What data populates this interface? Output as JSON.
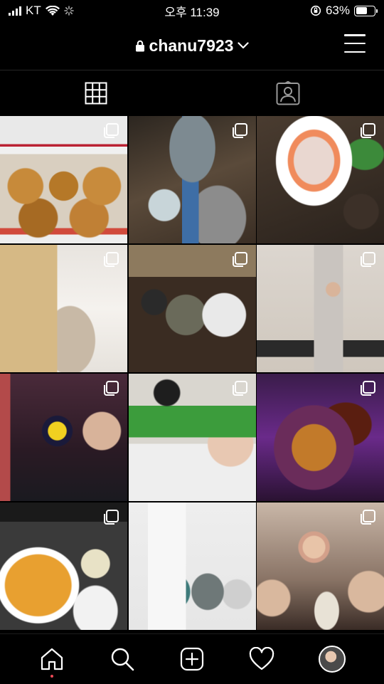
{
  "status_bar": {
    "carrier": "KT",
    "time": "오후 11:39",
    "battery": "63%",
    "battery_level": 0.63
  },
  "header": {
    "username": "chanu7923"
  },
  "tabs": [
    {
      "name": "posts-grid",
      "icon": "grid-icon",
      "active": true
    },
    {
      "name": "tagged",
      "icon": "tagged-person-icon",
      "active": false
    }
  ],
  "posts": [
    {
      "description": "fried chicken boxes",
      "multi": true
    },
    {
      "description": "soju bottle and grill",
      "multi": true
    },
    {
      "description": "sashimi platter",
      "multi": true
    },
    {
      "description": "rice cake gift bags",
      "multi": true
    },
    {
      "description": "group dinner at table",
      "multi": true
    },
    {
      "description": "busker with mic stand",
      "multi": true
    },
    {
      "description": "selfie in bar",
      "multi": true
    },
    {
      "description": "volunteers selfie",
      "multi": true
    },
    {
      "description": "spicy chicken noodle plate",
      "multi": true
    },
    {
      "description": "tteokbokki bowl",
      "multi": true
    },
    {
      "description": "airpods cases",
      "multi": false
    },
    {
      "description": "friends at restaurant",
      "multi": true
    }
  ],
  "bottom_nav": [
    {
      "name": "home",
      "icon": "home-icon",
      "notification": true
    },
    {
      "name": "search",
      "icon": "search-icon"
    },
    {
      "name": "new-post",
      "icon": "add-post-icon"
    },
    {
      "name": "activity",
      "icon": "heart-icon"
    },
    {
      "name": "profile",
      "icon": "profile-avatar-icon"
    }
  ]
}
